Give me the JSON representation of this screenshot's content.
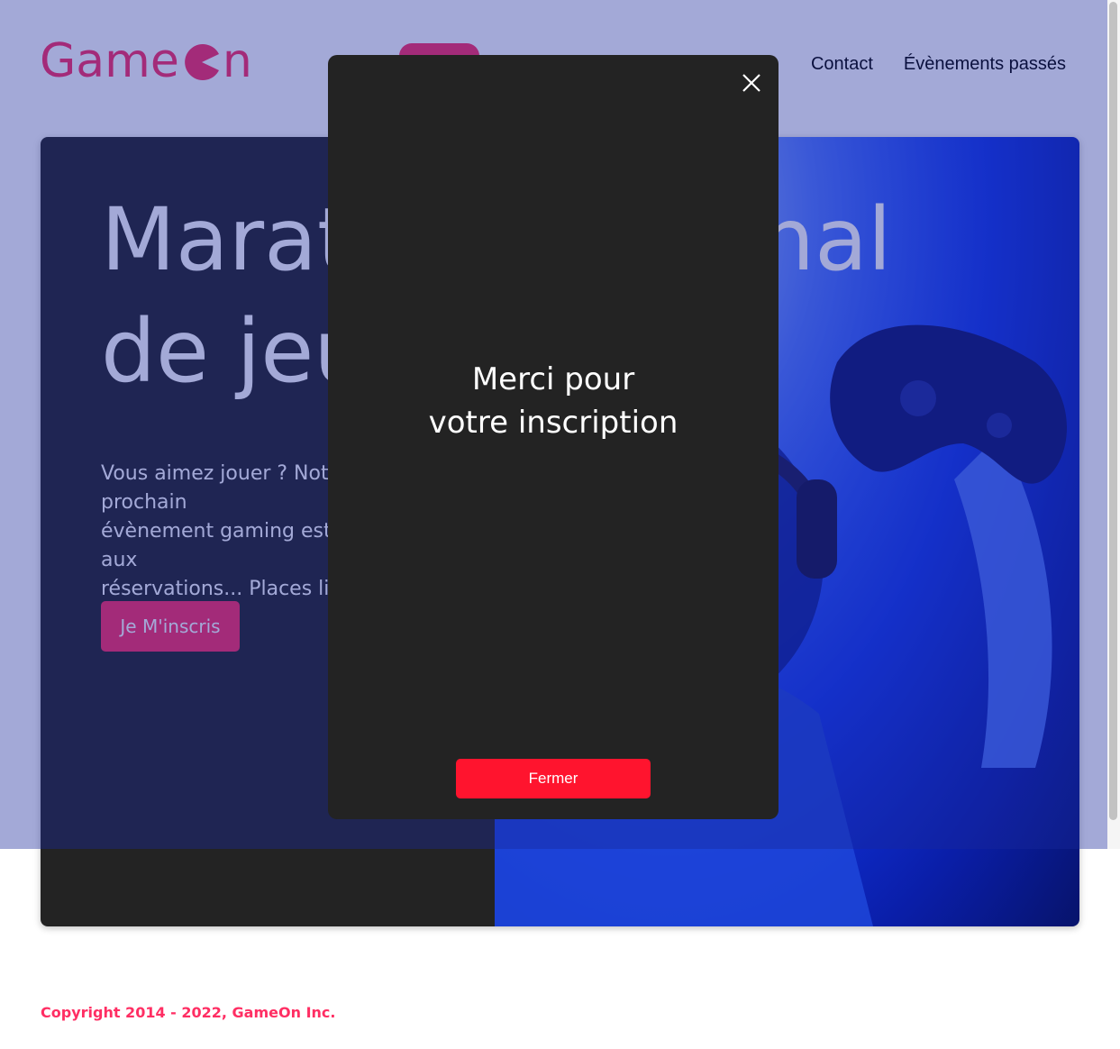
{
  "brand": {
    "logo_text_before": "Game",
    "logo_text_after": "n",
    "accent_color": "#FF2E63"
  },
  "nav": {
    "items": [
      {
        "label": "Contact"
      },
      {
        "label": "Évènements passés"
      }
    ]
  },
  "hero": {
    "title": "Marathon national\nde jeux vidéos",
    "text": "Vous aimez jouer ? Notre prochain\névènement gaming est ouvert aux\nréservations... Places limitées !",
    "cta_label": "Je M'inscris"
  },
  "modal": {
    "message": "Merci pour\nvotre inscription",
    "close_icon": "close-icon",
    "button_label": "Fermer",
    "button_color": "#FF142E"
  },
  "footer": {
    "copyright": "Copyright 2014 - 2022, GameOn Inc."
  }
}
